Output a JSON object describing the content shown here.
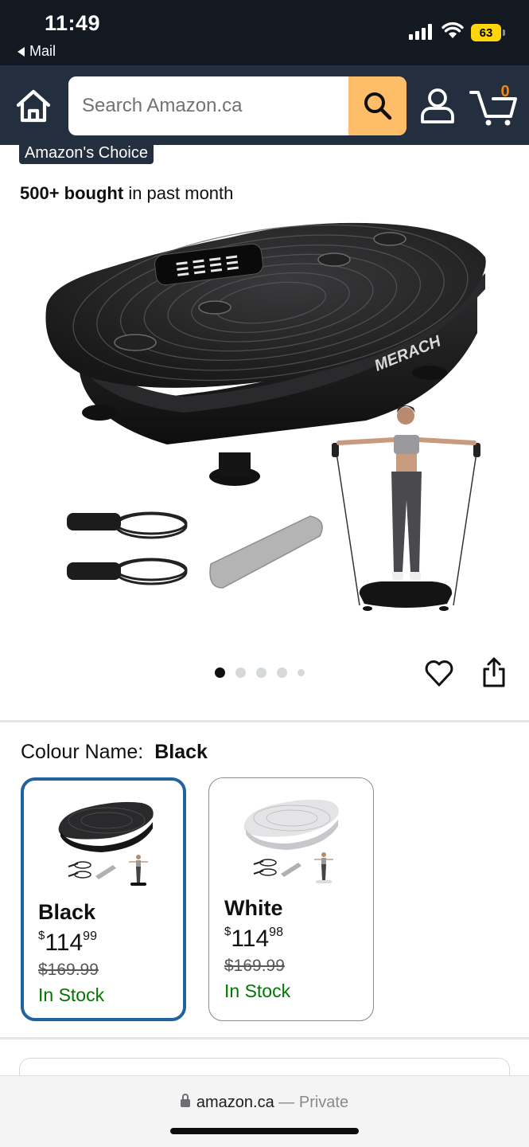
{
  "status_bar": {
    "time": "11:49",
    "back_app": "Mail",
    "battery": "63"
  },
  "header": {
    "search_placeholder": "Search Amazon.ca",
    "cart_count": "0",
    "colors": {
      "background": "#232f3e",
      "search_button": "#febd69"
    }
  },
  "product": {
    "badge": "Amazon's Choice",
    "bought_bold": "500+ bought",
    "bought_rest": "in past month",
    "brand_mark": "MERACH",
    "image_dots": 5,
    "active_dot": 1
  },
  "colour": {
    "label": "Colour Name:",
    "selected": "Black",
    "options": [
      {
        "name": "Black",
        "currency": "$",
        "price_whole": "114",
        "price_cents": "99",
        "was": "$169.99",
        "stock": "In Stock",
        "selected": true
      },
      {
        "name": "White",
        "currency": "$",
        "price_whole": "114",
        "price_cents": "98",
        "was": "$169.99",
        "stock": "In Stock",
        "selected": false
      }
    ]
  },
  "browser": {
    "domain": "amazon.ca",
    "separator": "—",
    "mode": "Private"
  }
}
